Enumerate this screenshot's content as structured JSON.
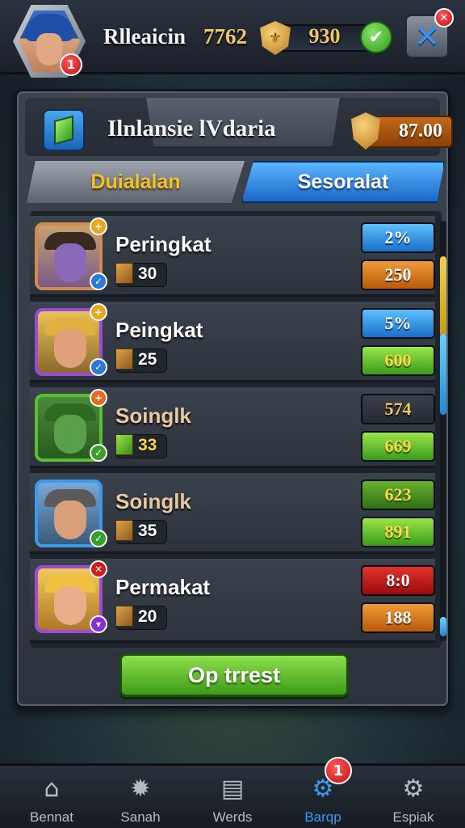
{
  "topbar": {
    "player_name": "Rlleaicin",
    "player_level": "7762",
    "avatar_badge": "1",
    "coins": "930"
  },
  "panel": {
    "title": "Ilnlansie lVdaria",
    "gold": "87.00",
    "tabs": [
      {
        "label": "Duialalan",
        "active": false
      },
      {
        "label": "Sesoralat",
        "active": true
      }
    ],
    "rows": [
      {
        "name": "Peringkat",
        "stat": "30",
        "top_value": "2%",
        "bottom_value": "250",
        "name_color": "#ffffff"
      },
      {
        "name": "Peingkat",
        "stat": "25",
        "top_value": "5%",
        "bottom_value": "600",
        "name_color": "#ffffff"
      },
      {
        "name": "Soinglk",
        "stat": "33",
        "top_value": "574",
        "bottom_value": "669",
        "name_color": "#e9c9a0"
      },
      {
        "name": "Soinglk",
        "stat": "35",
        "top_value": "623",
        "bottom_value": "891",
        "name_color": "#e9c9a0"
      },
      {
        "name": "Permakat",
        "stat": "20",
        "top_value": "8:0",
        "bottom_value": "188",
        "name_color": "#ffffff"
      }
    ],
    "cta_label": "Op trrest"
  },
  "bottom_nav": {
    "items": [
      {
        "label": "Bennat",
        "icon": "home-icon",
        "active": false
      },
      {
        "label": "Sanah",
        "icon": "star-gear-icon",
        "active": false
      },
      {
        "label": "Werds",
        "icon": "cards-icon",
        "active": false
      },
      {
        "label": "Barqp",
        "icon": "gear-icon",
        "active": true
      },
      {
        "label": "Espiak",
        "icon": "settings-icon",
        "active": false
      }
    ],
    "badge": "1"
  },
  "colors": {
    "accent_blue": "#3a9af0",
    "gold": "#f0c66a",
    "cta_green": "#5cb82a"
  }
}
